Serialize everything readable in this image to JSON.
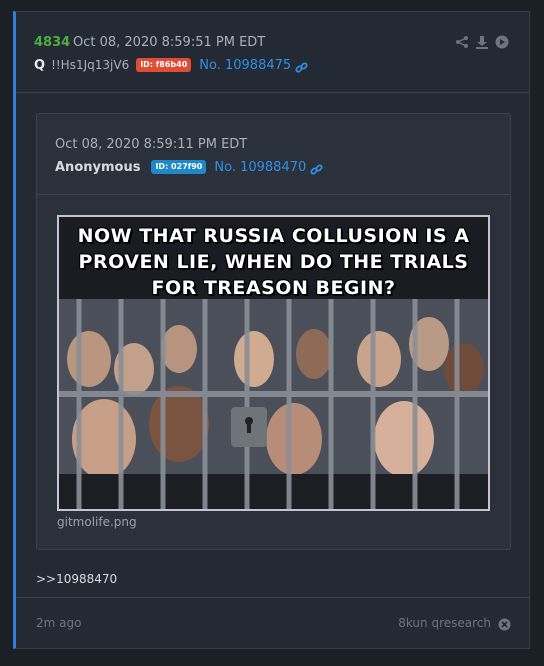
{
  "post": {
    "number": "4834",
    "date": "Oct 08, 2020 8:59:51 PM EDT",
    "author": "Q",
    "tripcode": "!!Hs1Jq13jV6",
    "id_badge": "ID: f86b40",
    "post_no": "No. 10988475",
    "body": ">>10988470"
  },
  "quoted": {
    "date": "Oct 08, 2020 8:59:11 PM EDT",
    "author": "Anonymous",
    "id_badge": "ID: 027f90",
    "post_no": "No. 10988470",
    "filename": "gitmolife.png",
    "image_text": [
      "NOW THAT RUSSIA COLLUSION IS A",
      "PROVEN LIE, WHEN DO THE TRIALS",
      "FOR TREASON BEGIN?"
    ]
  },
  "footer": {
    "time_ago": "2m ago",
    "board": "8kun qresearch"
  },
  "colors": {
    "accent": "#2f7ed8",
    "post_number": "#4caf3c",
    "link": "#2f8fe8",
    "id_red": "#e04d35",
    "id_blue": "#1e88c8"
  },
  "icons": [
    "share-icon",
    "download-icon",
    "open-icon",
    "link-icon",
    "close-icon"
  ]
}
